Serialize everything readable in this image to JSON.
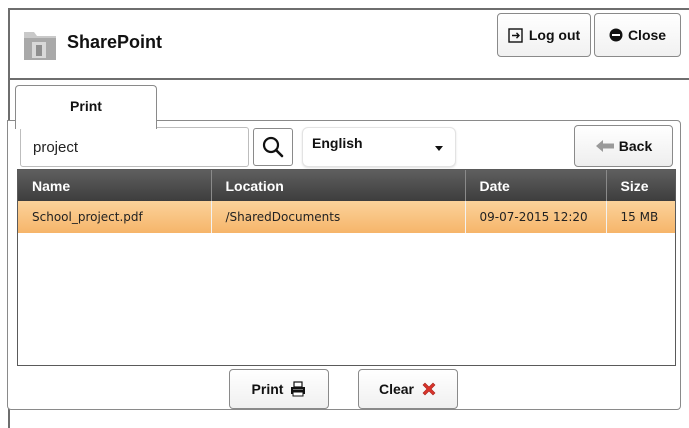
{
  "app": {
    "title": "SharePoint"
  },
  "header": {
    "logout_label": "Log out",
    "close_label": "Close"
  },
  "tabs": [
    {
      "label": "Print"
    }
  ],
  "search": {
    "value": "project"
  },
  "language": {
    "selected": "English"
  },
  "back_label": "Back",
  "table": {
    "columns": [
      "Name",
      "Location",
      "Date",
      "Size"
    ],
    "rows": [
      {
        "name": "School_project.pdf",
        "location": "/SharedDocuments",
        "date": "09-07-2015 12:20",
        "size": "15 MB",
        "selected": true
      }
    ]
  },
  "actions": {
    "print_label": "Print",
    "clear_label": "Clear"
  },
  "icons": {
    "app": "sharepoint-folder-icon",
    "logout": "logout-icon",
    "close": "stop-circle-icon",
    "search": "magnifier-icon",
    "dropdown": "caret-down-icon",
    "back": "left-arrow-icon",
    "print": "printer-icon",
    "clear": "red-x-icon"
  },
  "colors": {
    "selected_row": "#f6b56a",
    "header_bg": "#4a4a4a",
    "clear_icon": "#d9342b"
  }
}
